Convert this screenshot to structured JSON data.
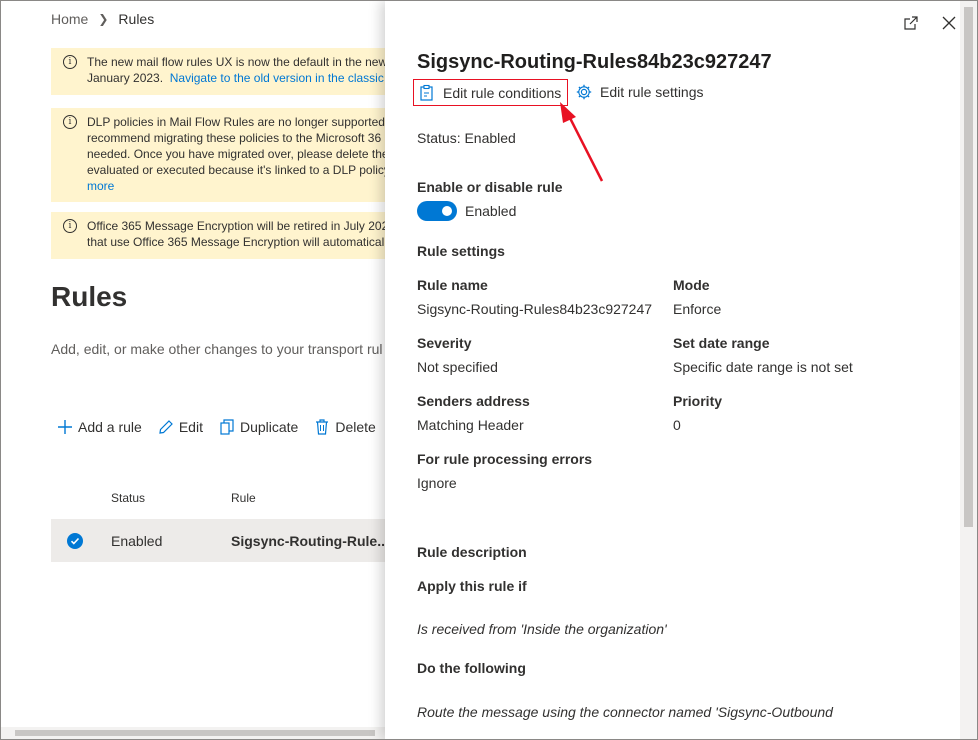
{
  "breadcrumb": {
    "home": "Home",
    "current": "Rules"
  },
  "banners": {
    "b1_line1": "The new mail flow rules UX is now the default in the new",
    "b1_line2": "January 2023.",
    "b1_link": "Navigate to the old version in the classic E",
    "b2_line1": "DLP policies in Mail Flow Rules are no longer supported,",
    "b2_line2": "recommend migrating these policies to the Microsoft 36",
    "b2_line3": "needed. Once you have migrated over, please delete the",
    "b2_line4": "evaluated or executed because it's linked to a DLP policy",
    "b2_link": "more",
    "b3_line1": "Office 365 Message Encryption will be retired in July 202",
    "b3_line2": "that use Office 365 Message Encryption will automaticall"
  },
  "page": {
    "title": "Rules",
    "description": "Add, edit, or make other changes to your transport rul"
  },
  "toolbar": {
    "add": "Add a rule",
    "edit": "Edit",
    "duplicate": "Duplicate",
    "delete": "Delete"
  },
  "table": {
    "headers": {
      "status": "Status",
      "rule": "Rule"
    },
    "rows": [
      {
        "status": "Enabled",
        "rule": "Sigsync-Routing-Rule..."
      }
    ]
  },
  "panel": {
    "title": "Sigsync-Routing-Rules84b23c927247",
    "edit_conditions": "Edit rule conditions",
    "edit_settings": "Edit rule settings",
    "status": "Status: Enabled",
    "enable_heading": "Enable or disable rule",
    "toggle_label": "Enabled",
    "rule_settings_heading": "Rule settings",
    "fields": {
      "rule_name_label": "Rule name",
      "rule_name_value": "Sigsync-Routing-Rules84b23c927247",
      "mode_label": "Mode",
      "mode_value": "Enforce",
      "severity_label": "Severity",
      "severity_value": "Not specified",
      "date_range_label": "Set date range",
      "date_range_value": "Specific date range is not set",
      "senders_label": "Senders address",
      "senders_value": "Matching Header",
      "priority_label": "Priority",
      "priority_value": "0",
      "errors_label": "For rule processing errors",
      "errors_value": "Ignore"
    },
    "description_heading": "Rule description",
    "apply_heading": "Apply this rule if",
    "apply_value": "Is received from 'Inside the organization'",
    "do_heading": "Do the following",
    "do_value": "Route the message using the connector named 'Sigsync-Outbound"
  },
  "colors": {
    "accent": "#0078d4",
    "highlight_border": "#e81123",
    "banner_bg": "#fff4ce"
  }
}
